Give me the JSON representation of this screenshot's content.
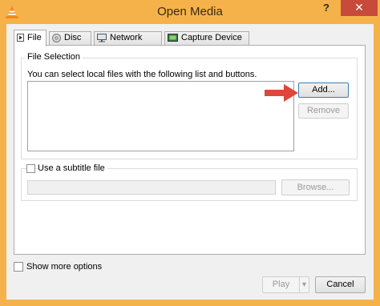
{
  "window": {
    "title": "Open Media",
    "help_label": "?",
    "close_label": "✕"
  },
  "tabs": [
    {
      "label": "File",
      "icon": "file-icon"
    },
    {
      "label": "Disc",
      "icon": "disc-icon"
    },
    {
      "label": "Network",
      "icon": "network-icon"
    },
    {
      "label": "Capture Device",
      "icon": "capture-device-icon"
    }
  ],
  "file_selection": {
    "title": "File Selection",
    "hint": "You can select local files with the following list and buttons.",
    "add_label": "Add...",
    "remove_label": "Remove"
  },
  "subtitle": {
    "checkbox_label": "Use a subtitle file",
    "browse_label": "Browse..."
  },
  "footer": {
    "show_more_label": "Show more options",
    "play_label": "Play",
    "dropdown_label": "▾",
    "cancel_label": "Cancel"
  },
  "colors": {
    "frame": "#f6b24a",
    "close_button": "#c74a3a",
    "annotation_arrow": "#e0463a"
  }
}
